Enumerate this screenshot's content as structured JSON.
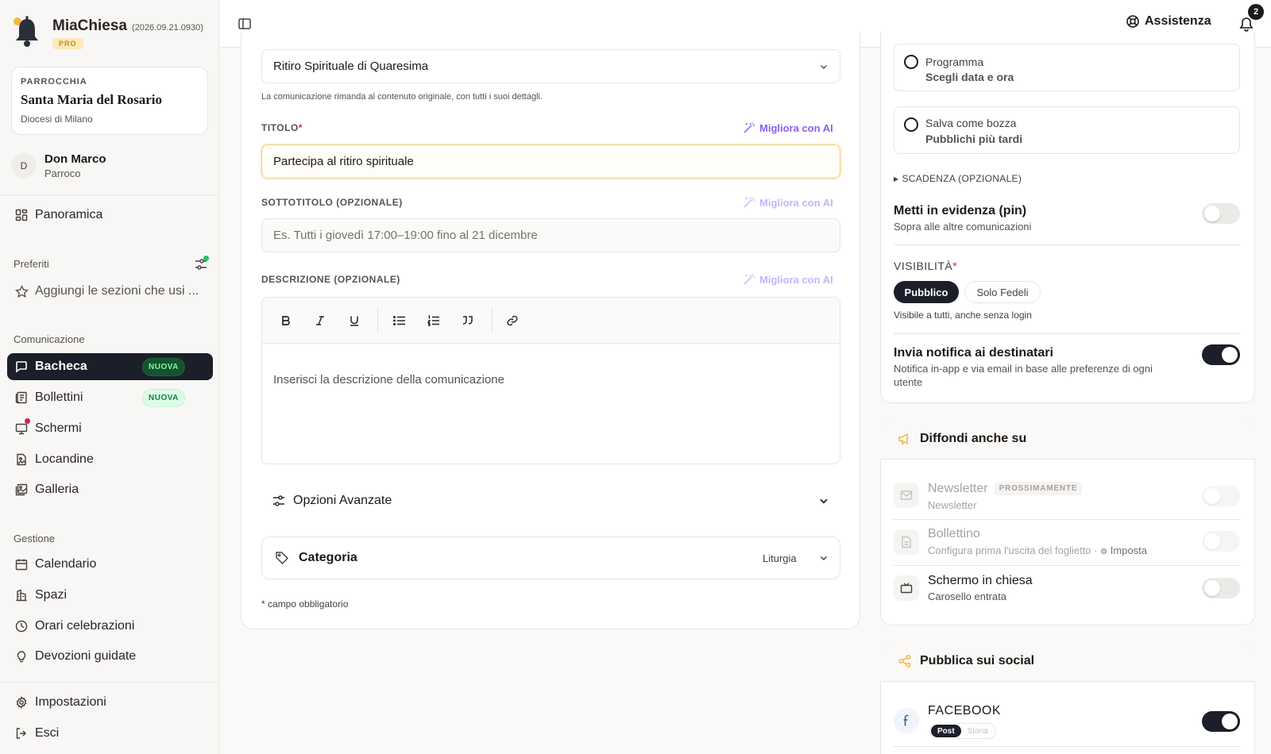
{
  "brand": {
    "name": "MiaChiesa",
    "version": "(2026.09.21.0930)",
    "plan": "PRO"
  },
  "parish": {
    "label": "PARROCCHIA",
    "name": "Santa Maria del Rosario",
    "diocese": "Diocesi di Milano"
  },
  "user": {
    "initial": "D",
    "name": "Don Marco",
    "role": "Parroco"
  },
  "sidebar": {
    "overview": "Panoramica",
    "favorites_label": "Preferiti",
    "favorites_hint": "Aggiungi le sezioni che usi ...",
    "communication_label": "Comunicazione",
    "communication_items": [
      {
        "label": "Bacheca",
        "badge": "NUOVA"
      },
      {
        "label": "Bollettini",
        "badge": "NUOVA"
      },
      {
        "label": "Schermi"
      },
      {
        "label": "Locandine"
      },
      {
        "label": "Galleria"
      }
    ],
    "management_label": "Gestione",
    "management_items": [
      {
        "label": "Calendario"
      },
      {
        "label": "Spazi"
      },
      {
        "label": "Orari celebrazioni"
      },
      {
        "label": "Devozioni guidate"
      }
    ],
    "settings": "Impostazioni",
    "logout": "Esci"
  },
  "topbar": {
    "help": "Assistenza",
    "notifications_count": "2"
  },
  "form": {
    "linked_content_value": "Ritiro Spirituale di Quaresima",
    "linked_content_help": "La comunicazione rimanda al contenuto originale, con tutti i suoi dettagli.",
    "ai_label": "Migliora con AI",
    "title_label": "TITOLO",
    "required_mark": "*",
    "title_value": "Partecipa al ritiro spirituale",
    "subtitle_label": "SOTTOTITOLO (OPZIONALE)",
    "subtitle_placeholder": "Es. Tutti i giovedì 17:00–19:00 fino al 21 dicembre",
    "description_label": "DESCRIZIONE (OPZIONALE)",
    "description_placeholder": "Inserisci la descrizione della comunicazione",
    "advanced_options": "Opzioni Avanzate",
    "category_label": "Categoria",
    "category_value": "Liturgia",
    "required_note": "* campo obbligatorio"
  },
  "publish": {
    "schedule_title": "Programma",
    "schedule_sub": "Scegli data e ora",
    "draft_title": "Salva come bozza",
    "draft_sub": "Pubblichi più tardi",
    "expiry": "SCADENZA (OPZIONALE)",
    "pin_title": "Metti in evidenza (pin)",
    "pin_sub": "Sopra alle altre comunicazioni",
    "visibility_label": "VISIBILITÀ",
    "visibility_options": [
      "Pubblico",
      "Solo Fedeli"
    ],
    "visibility_help": "Visibile a tutti, anche senza login",
    "notify_title": "Invia notifica ai destinatari",
    "notify_sub": "Notifica in-app e via email in base alle preferenze di ogni utente"
  },
  "spread": {
    "title": "Diffondi anche su",
    "newsletter_title": "Newsletter",
    "newsletter_badge": "PROSSIMAMENTE",
    "newsletter_sub": "Newsletter",
    "bulletin_title": "Bollettino",
    "bulletin_sub": "Configura prima l'uscita del foglietto ·",
    "bulletin_link": "Imposta",
    "screen_title": "Schermo in chiesa",
    "screen_sub": "Carosello entrata"
  },
  "social": {
    "title": "Pubblica sui social",
    "facebook": "FACEBOOK",
    "formats": [
      "Post",
      "Storia"
    ]
  }
}
